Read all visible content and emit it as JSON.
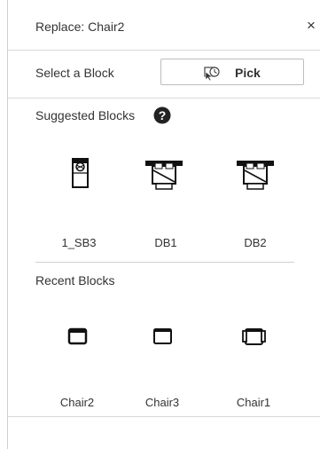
{
  "dialog": {
    "title": "Replace: Chair2",
    "close_label": "×"
  },
  "select_block": {
    "label": "Select a Block",
    "pick_label": "Pick"
  },
  "suggested": {
    "title": "Suggested Blocks",
    "help_icon": "help-question-icon",
    "items": [
      {
        "label": "1_SB3",
        "icon": "single-bed-block-icon"
      },
      {
        "label": "DB1",
        "icon": "double-bed-block-icon"
      },
      {
        "label": "DB2",
        "icon": "double-bed-block-icon"
      }
    ]
  },
  "recent": {
    "title": "Recent Blocks",
    "items": [
      {
        "label": "Chair2",
        "icon": "chair-block-icon"
      },
      {
        "label": "Chair3",
        "icon": "chair-block-icon"
      },
      {
        "label": "Chair1",
        "icon": "armchair-block-icon"
      }
    ]
  },
  "colors": {
    "text": "#333333",
    "border": "#d9d9d9",
    "icon": "#111111"
  }
}
